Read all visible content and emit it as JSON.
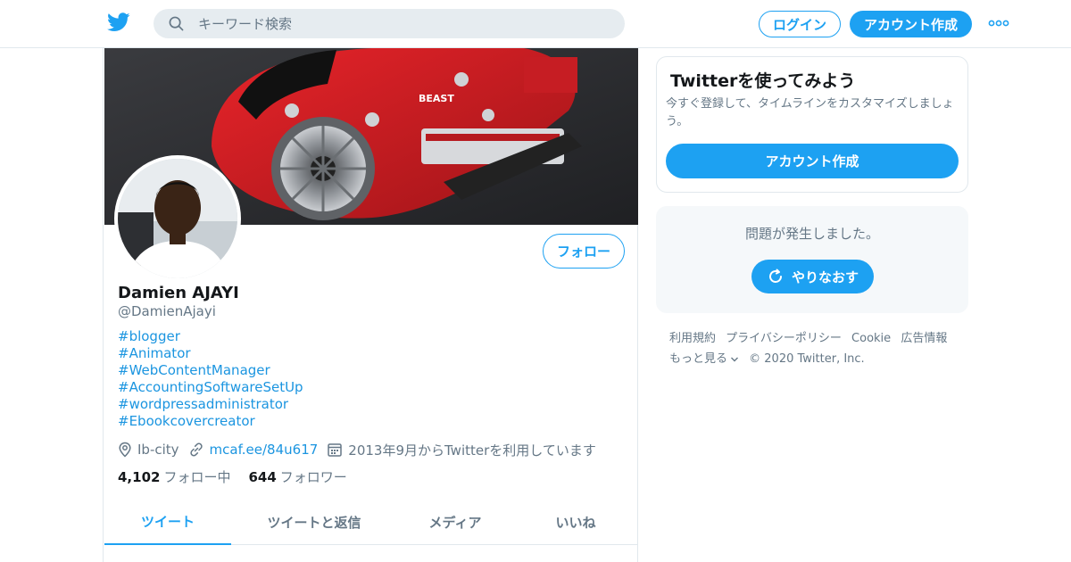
{
  "header": {
    "logo_icon": "twitter-bird-icon",
    "search_placeholder": "キーワード検索",
    "login_label": "ログイン",
    "signup_label": "アカウント作成",
    "more_icon": "more-dots-icon",
    "brand_color": "#1da1f2"
  },
  "profile": {
    "name": "Damien AJAYI",
    "handle": "@DamienAjayi",
    "follow_label": "フォロー",
    "bio_hashtags": [
      "#blogger",
      "#Animator",
      "#WebContentManager",
      "#AccountingSoftwareSetUp",
      "#wordpressadministrator",
      "#Ebookcovercreator"
    ],
    "location": "Ib-city",
    "website": "mcaf.ee/84u617",
    "joined": "2013年9月からTwitterを利用しています",
    "following_count": "4,102",
    "following_label": "フォロー中",
    "followers_count": "644",
    "followers_label": "フォロワー",
    "banner_text": "BEAST"
  },
  "tabs": [
    {
      "label": "ツイート",
      "active": true
    },
    {
      "label": "ツイートと返信",
      "active": false
    },
    {
      "label": "メディア",
      "active": false
    },
    {
      "label": "いいね",
      "active": false
    }
  ],
  "sidebar": {
    "promo_title": "Twitterを使ってみよう",
    "promo_desc": "今すぐ登録して、タイムラインをカスタマイズしましょう。",
    "promo_button": "アカウント作成",
    "error_text": "問題が発生しました。",
    "retry_label": "やりなおす"
  },
  "footer": {
    "links": [
      "利用規約",
      "プライバシーポリシー",
      "Cookie",
      "広告情報"
    ],
    "more_label": "もっと見る",
    "copyright": "© 2020 Twitter, Inc."
  }
}
